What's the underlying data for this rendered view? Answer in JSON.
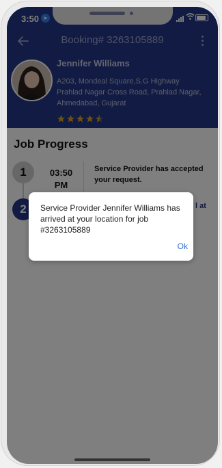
{
  "status_bar": {
    "time": "3:50"
  },
  "header": {
    "booking_title": "Booking# 3263105889",
    "provider_name": "Jennifer Williams",
    "address_line1": "A203, Mondeal Square,S.G Highway",
    "address_line2": "Prahlad Nagar Cross Road, Prahlad Nagar,",
    "address_line3": "Ahmedabad, Gujarat",
    "rating": 4.5,
    "star_color": "#d4a12a"
  },
  "job_progress": {
    "title": "Job Progress",
    "steps": [
      {
        "number": "1",
        "time_line1": "03:50",
        "time_line2": "PM",
        "description": "Service Provider has accepted your request."
      },
      {
        "number": "2",
        "description_partial": "l at"
      }
    ]
  },
  "dialog": {
    "message": "Service Provider Jennifer Williams has arrived at your location for job #3263105889",
    "ok_label": "Ok"
  },
  "colors": {
    "primary": "#243787",
    "link": "#2f6fd8"
  }
}
